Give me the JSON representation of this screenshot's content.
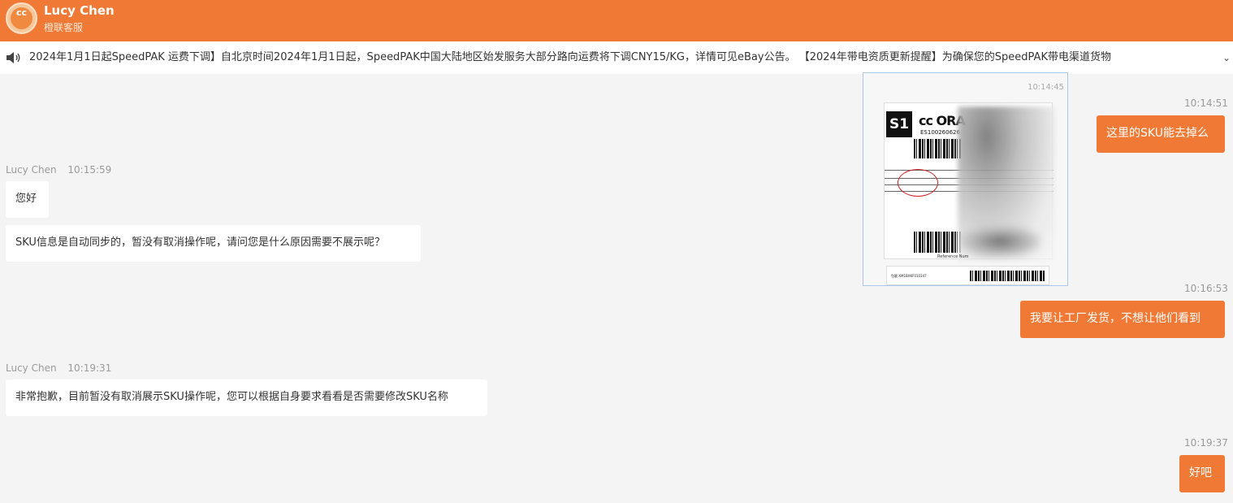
{
  "header": {
    "agent_name": "Lucy Chen",
    "agent_subtitle": "橙联客服",
    "avatar_icon": "orange-connect-logo"
  },
  "notice": {
    "icon": "speaker-icon",
    "text": "2024年1月1日起SpeedPAK 运费下调】自北京时间2024年1月1日起，SpeedPAK中国大陆地区始发服务大部分路向运费将下调CNY15/KG，详情可见eBay公告。 【2024年带电资质更新提醒】为确保您的SpeedPAK带电渠道货物",
    "expand_icon": "chevron-down-icon"
  },
  "messages": {
    "image_msg": {
      "time": "10:14:45",
      "label_s1": "S1",
      "label_logo": "ᴄᴄ ORA",
      "label_tracking": "ES100260626",
      "label_reference": "Reference Num",
      "label_bottom": "包裹 XM1BXKF010347"
    },
    "out1": {
      "time": "10:14:51",
      "text": "这里的SKU能去掉么"
    },
    "in1": {
      "sender": "Lucy Chen",
      "time": "10:15:59",
      "text": "您好"
    },
    "in2": {
      "text": "SKU信息是自动同步的，暂没有取消操作呢，请问您是什么原因需要不展示呢？"
    },
    "out2": {
      "time": "10:16:53",
      "text": "我要让工厂发货，不想让他们看到"
    },
    "in3": {
      "sender": "Lucy Chen",
      "time": "10:19:31",
      "text": "非常抱歉，目前暂没有取消展示SKU操作呢，您可以根据自身要求看看是否需要修改SKU名称"
    },
    "out3": {
      "time": "10:19:37",
      "text": "好吧"
    }
  },
  "colors": {
    "accent": "#f07a35",
    "background": "#f4f4f4",
    "bubble_in": "#ffffff"
  }
}
